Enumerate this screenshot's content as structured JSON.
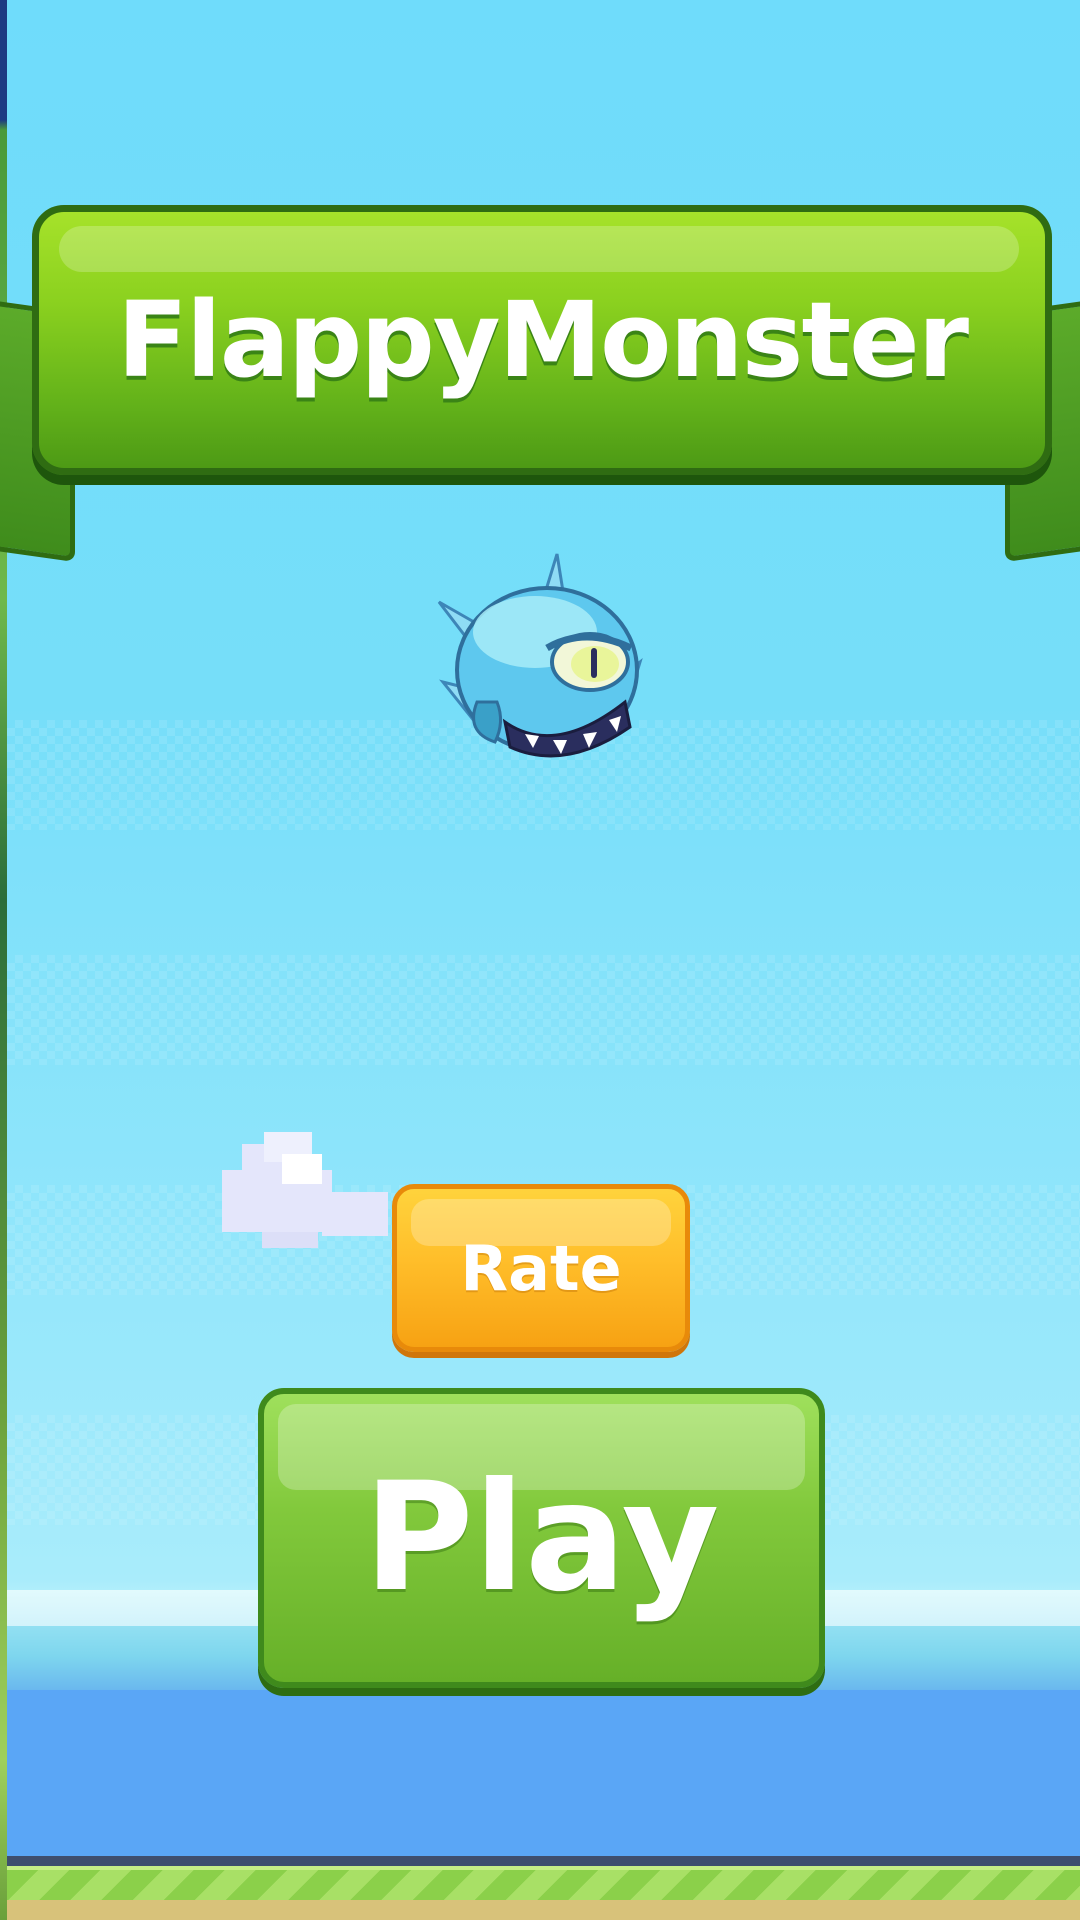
{
  "title": "FlappyMonster",
  "buttons": {
    "rate_label": "Rate",
    "play_label": "Play"
  },
  "sprites": {
    "player": "monster-icon",
    "cloud": "cloud-icon"
  },
  "colors": {
    "sky": "#70dcfa",
    "banner_green": "#8bd11f",
    "rate_orange": "#ffbe2a",
    "play_green": "#82c93c",
    "water": "#5aa6f6"
  }
}
